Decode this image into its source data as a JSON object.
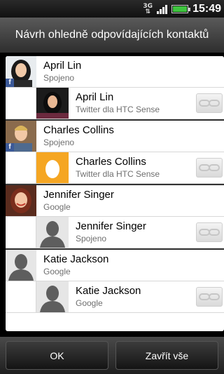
{
  "status_bar": {
    "network": "3G",
    "time": "15:49"
  },
  "dialog": {
    "title": "Návrh ohledně odpovídajících kontaktů"
  },
  "groups": [
    {
      "primary": {
        "name": "April Lin",
        "source": "Spojeno",
        "avatar": "photo-woman-dark-hair",
        "badge": "f"
      },
      "linked": {
        "name": "April Lin",
        "source": "Twitter dla HTC Sense",
        "avatar": "photo-woman-dark-hair"
      }
    },
    {
      "primary": {
        "name": "Charles Collins",
        "source": "Spojeno",
        "avatar": "photo-man-blond",
        "badge": "f"
      },
      "linked": {
        "name": "Charles Collins",
        "source": "Twitter dla HTC Sense",
        "avatar": "egg-icon"
      }
    },
    {
      "primary": {
        "name": "Jennifer Singer",
        "source": "Google",
        "avatar": "photo-woman-red-hair"
      },
      "linked": {
        "name": "Jennifer Singer",
        "source": "Spojeno",
        "avatar": "default-person-icon"
      }
    },
    {
      "primary": {
        "name": "Katie Jackson",
        "source": "Google",
        "avatar": "default-person-icon"
      },
      "linked": {
        "name": "Katie Jackson",
        "source": "Google",
        "avatar": "default-person-icon"
      }
    }
  ],
  "buttons": {
    "ok": "OK",
    "close_all": "Zavřít vše"
  },
  "colors": {
    "battery": "#3ec43e",
    "facebook": "#3b5998",
    "twitter_egg_bg": "#f5a623"
  }
}
